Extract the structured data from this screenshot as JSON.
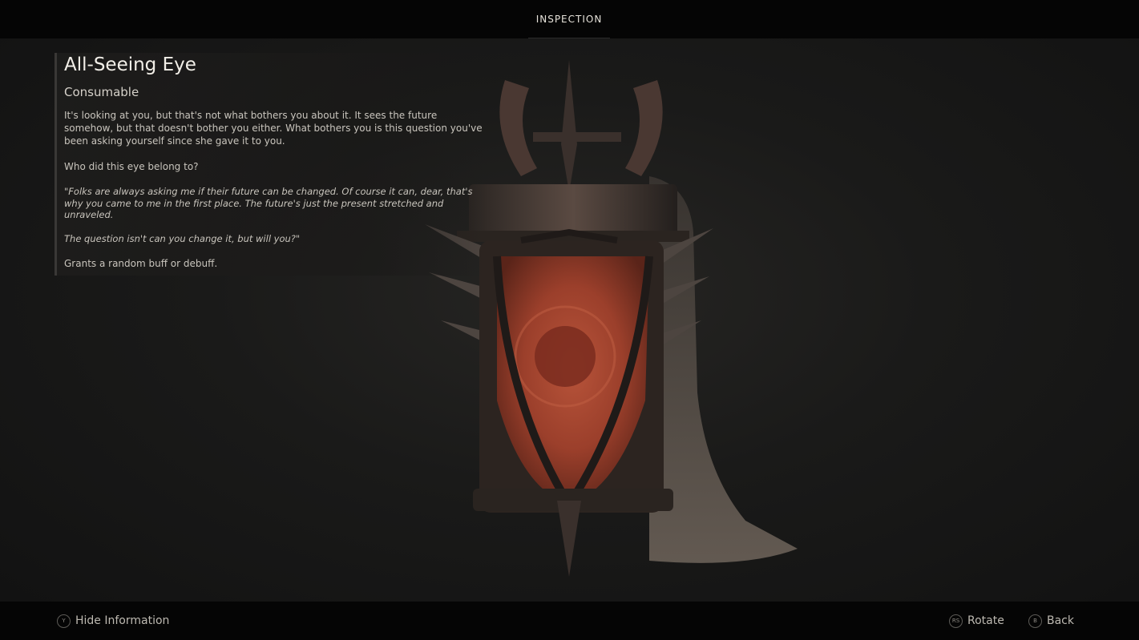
{
  "header": {
    "tab_label": "INSPECTION"
  },
  "item": {
    "name": "All-Seeing Eye",
    "category": "Consumable",
    "description": "It's looking at you, but that's not what bothers you about it. It sees the future somehow, but that doesn't bother you either. What bothers you is this question you've been asking yourself since she gave it to you.",
    "question": "Who did this eye belong to?",
    "quote_1": "\"Folks are always asking me if their future can be changed. Of course it can, dear, that's why you came to me in the first place. The future's just the present stretched and unraveled.",
    "quote_2": "The question isn't can you change it, but will you?\"",
    "effect": "Grants a random buff or debuff."
  },
  "footer": {
    "hide_info": {
      "glyph": "Y",
      "label": "Hide Information"
    },
    "rotate": {
      "glyph": "RS",
      "label": "Rotate"
    },
    "back": {
      "glyph": "B",
      "label": "Back"
    }
  },
  "colors": {
    "accent": "#e6e2da",
    "background": "#141414",
    "bar": "#050505",
    "eye": "#a9432c"
  },
  "icons": {
    "hide_info": "y-button-icon",
    "rotate": "right-stick-icon",
    "back": "b-button-icon"
  }
}
